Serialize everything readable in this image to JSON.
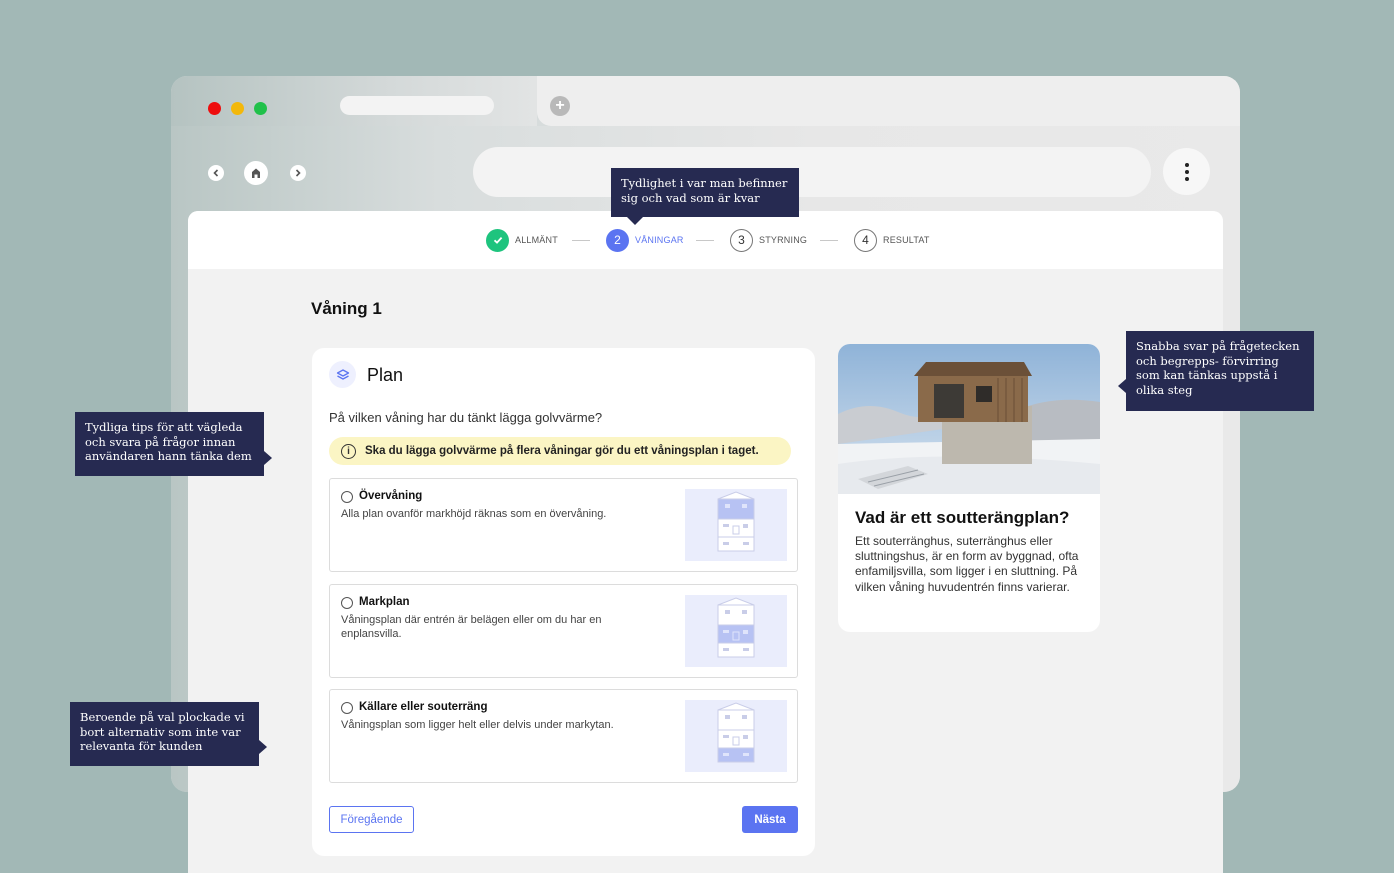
{
  "stepper": {
    "steps": [
      {
        "number": "",
        "label": "ALLMÄNT",
        "state": "done"
      },
      {
        "number": "2",
        "label": "VÅNINGAR",
        "state": "active"
      },
      {
        "number": "3",
        "label": "STYRNING",
        "state": "pending"
      },
      {
        "number": "4",
        "label": "RESULTAT",
        "state": "pending"
      }
    ]
  },
  "page": {
    "title": "Våning 1"
  },
  "plan_card": {
    "title": "Plan",
    "question": "På vilken våning har du tänkt lägga golvvärme?",
    "tip": "Ska du lägga golvvärme på flera våningar gör du ett våningsplan i taget.",
    "options": [
      {
        "title": "Övervåning",
        "description": "Alla plan ovanför markhöjd räknas som en övervåning.",
        "highlight": "top"
      },
      {
        "title": "Markplan",
        "description": "Våningsplan där entrén är belägen eller om du har en enplansvilla.",
        "highlight": "middle"
      },
      {
        "title": "Källare eller souterräng",
        "description": "Våningsplan som ligger helt eller delvis under markytan.",
        "highlight": "bottom"
      }
    ],
    "prev_label": "Föregående",
    "next_label": "Nästa"
  },
  "info_card": {
    "title": "Vad är ett soutterängplan?",
    "text": "Ett souterränghus, suterränghus eller sluttningshus, är en form av byggnad, ofta enfamiljsvilla, som ligger i en sluttning. På vilken våning huvudentrén finns varierar."
  },
  "callouts": {
    "top": "Tydlighet i var man befinner sig och vad som är kvar",
    "right": "Snabba svar på frågetecken och begrepps- förvirring som kan tänkas uppstå i olika steg",
    "left_upper": "Tydliga tips för att vägleda och svara på frågor innan användaren hann tänka dem",
    "left_lower": "Beroende på val plockade vi bort alternativ som inte var relevanta för kunden"
  },
  "colors": {
    "background": "#a2b8b6",
    "accent": "#5b74f1",
    "done": "#1ec47e",
    "tip_bg": "#fbf5c4",
    "callout_bg": "#262a51"
  },
  "icons": [
    "check-icon",
    "layers-icon",
    "info-icon",
    "back-arrow-icon",
    "home-icon",
    "forward-arrow-icon",
    "more-vertical-icon",
    "plus-icon"
  ]
}
